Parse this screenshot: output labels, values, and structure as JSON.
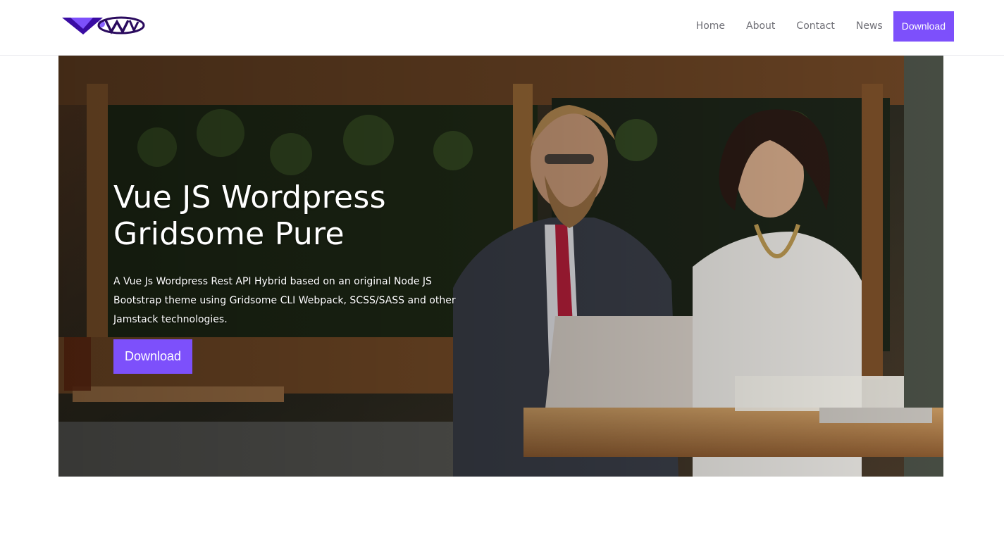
{
  "brand": {
    "logo_icon": "vw-logo",
    "accent_color": "#7d50fb",
    "logo_dark_color": "#2a0a5e"
  },
  "nav": {
    "items": [
      {
        "label": "Home"
      },
      {
        "label": "About"
      },
      {
        "label": "Contact"
      },
      {
        "label": "News"
      }
    ],
    "cta_label": "Download"
  },
  "hero": {
    "title_line1": "Vue JS Wordpress",
    "title_line2": "Gridsome Pure",
    "description": "A Vue Js Wordpress Rest API Hybrid based on an original Node JS Bootstrap theme using Gridsome CLI Webpack, SCSS/SASS and other Jamstack technologies.",
    "button_label": "Download"
  }
}
